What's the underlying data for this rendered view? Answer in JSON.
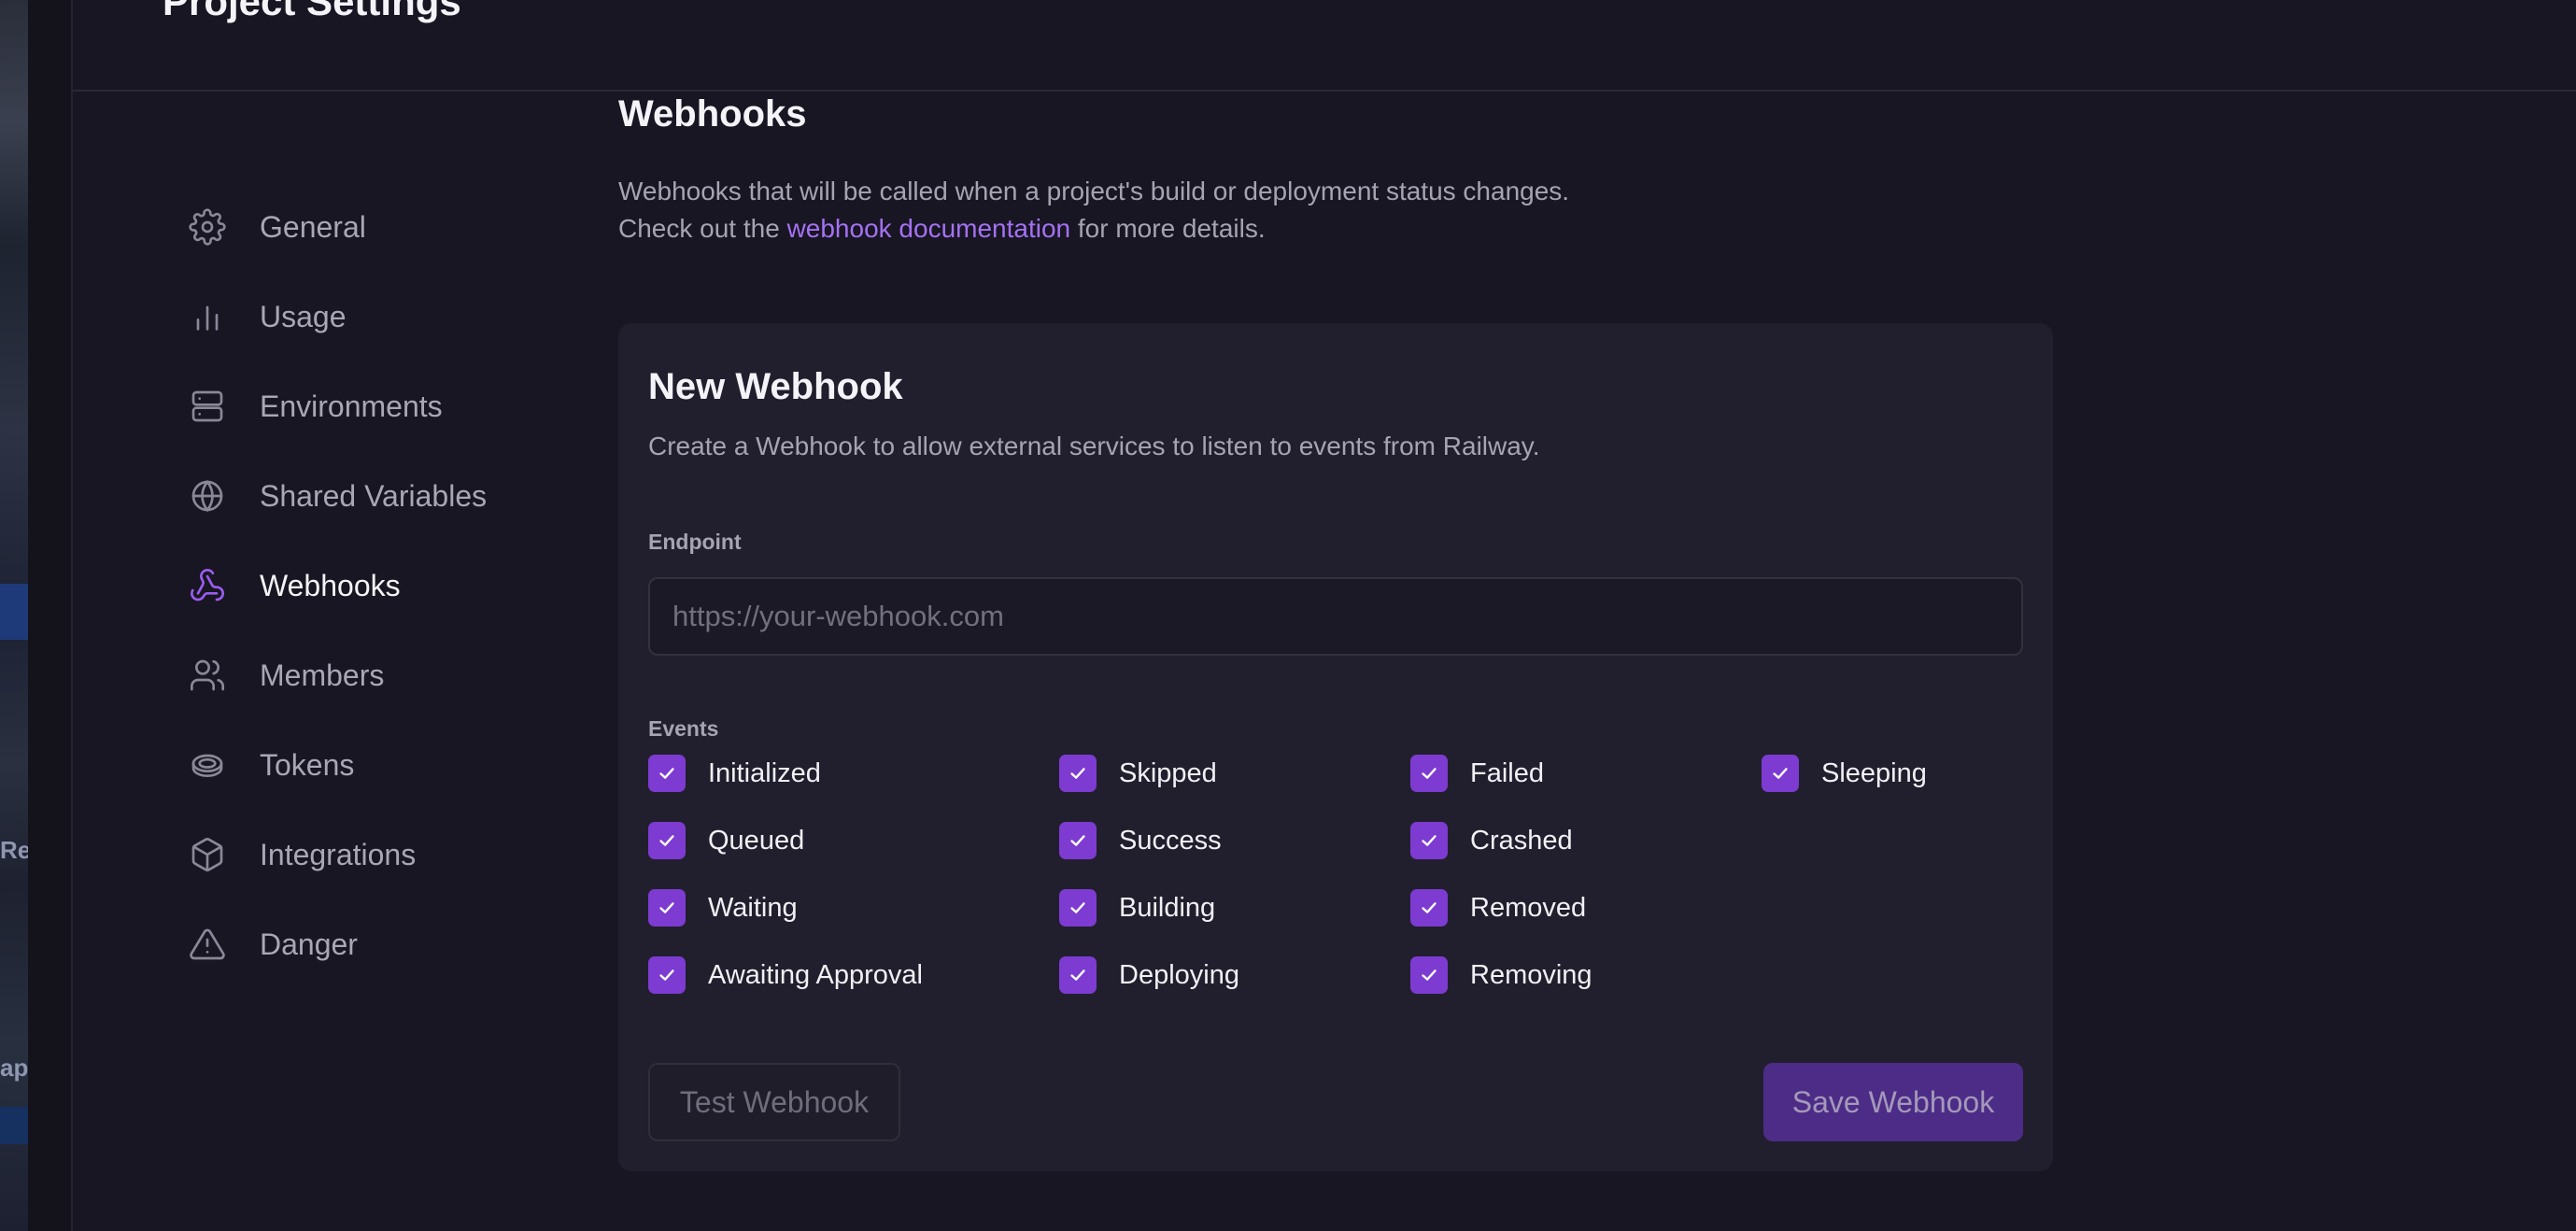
{
  "header": {
    "title": "Project Settings"
  },
  "sidebar": {
    "items": [
      {
        "label": "General",
        "icon": "gear-icon",
        "active": false
      },
      {
        "label": "Usage",
        "icon": "bar-chart-icon",
        "active": false
      },
      {
        "label": "Environments",
        "icon": "server-icon",
        "active": false
      },
      {
        "label": "Shared Variables",
        "icon": "globe-icon",
        "active": false
      },
      {
        "label": "Webhooks",
        "icon": "webhook-icon",
        "active": true
      },
      {
        "label": "Members",
        "icon": "users-icon",
        "active": false
      },
      {
        "label": "Tokens",
        "icon": "token-icon",
        "active": false
      },
      {
        "label": "Integrations",
        "icon": "box-icon",
        "active": false
      },
      {
        "label": "Danger",
        "icon": "warning-icon",
        "active": false
      }
    ]
  },
  "main": {
    "title": "Webhooks",
    "desc_line1": "Webhooks that will be called when a project's build or deployment status changes.",
    "desc_line2_prefix": "Check out the ",
    "desc_link": "webhook documentation",
    "desc_line2_suffix": " for more details."
  },
  "card": {
    "title": "New Webhook",
    "desc": "Create a Webhook to allow external services to listen to events from Railway.",
    "endpoint_label": "Endpoint",
    "endpoint_placeholder": "https://your-webhook.com",
    "endpoint_value": "",
    "events_label": "Events",
    "events": [
      {
        "label": "Initialized",
        "checked": true
      },
      {
        "label": "Queued",
        "checked": true
      },
      {
        "label": "Waiting",
        "checked": true
      },
      {
        "label": "Awaiting Approval",
        "checked": true
      },
      {
        "label": "Skipped",
        "checked": true
      },
      {
        "label": "Success",
        "checked": true
      },
      {
        "label": "Building",
        "checked": true
      },
      {
        "label": "Deploying",
        "checked": true
      },
      {
        "label": "Failed",
        "checked": true
      },
      {
        "label": "Crashed",
        "checked": true
      },
      {
        "label": "Removed",
        "checked": true
      },
      {
        "label": "Removing",
        "checked": true
      },
      {
        "label": "Sleeping",
        "checked": true
      }
    ],
    "test_button": "Test Webhook",
    "save_button": "Save Webhook"
  },
  "background": {
    "fragment1": "Re",
    "fragment2": "ap"
  },
  "colors": {
    "accent": "#7d3bd1",
    "link": "#a571f5",
    "background": "#181622",
    "card": "#211f2d"
  }
}
